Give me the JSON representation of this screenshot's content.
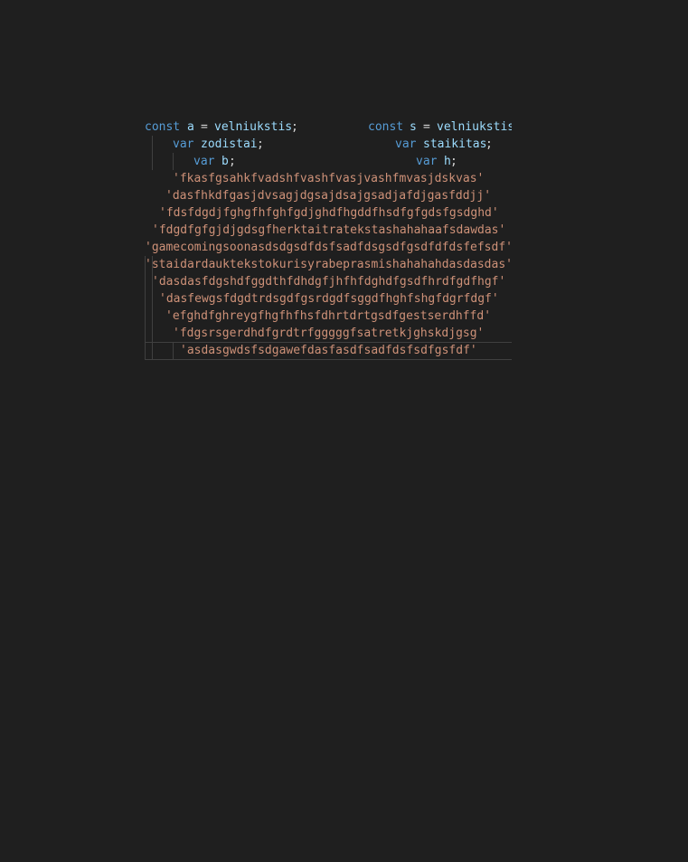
{
  "editor": {
    "header_left": {
      "kw": "const",
      "var": "a",
      "eq": "=",
      "value": "velniukstis",
      "semi": ";"
    },
    "header_right": {
      "kw": "const",
      "var": "s",
      "eq": "=",
      "value": "velniukstis"
    },
    "line2_left": {
      "kw": "var",
      "name": "zodistai",
      "semi": ";"
    },
    "line2_right": {
      "kw": "var",
      "name": "staikitas",
      "semi": ";"
    },
    "line3_left": {
      "kw": "var",
      "name": "b",
      "semi": ";"
    },
    "line3_right": {
      "kw": "var",
      "name": "h",
      "semi": ";"
    },
    "strings": [
      "'fkasfgsahkfvadshfvashfvasjvashfmvasjdskvas'",
      "'dasfhkdfgasjdvsagjdgsajdsajgsadjafdjgasfddjj'",
      "'fdsfdgdjfghgfhfghfgdjghdfhgddfhsdfgfgdsfgsdghd'",
      "'fdgdfgfgjdjgdsgfherktaitratekstashahahaafsdawdas'",
      "'gamecomingsoonasdsdgsdfdsfsadfdsgsdfgsdfdfdsfefsdf'",
      "'staidardauktekstokurisyrabeprasmishahahahdasdasdas'",
      "'dasdasfdgshdfggdthfdhdgfjhfhfdghdfgsdfhrdfgdfhgf'",
      "'dasfewgsfdgdtrdsgdfgsrdgdfsggdfhghfshgfdgrfdgf'",
      "'efghdfghreygfhgfhfhsfdhrtdrtgsdfgestserdhffd'",
      "'fdgsrsgerdhdfgrdtrfgggggfsatretkjghskdjgsg'",
      "'asdasgwdsfsdgawefdasfasdfsadfdsfsdfgsfdf'"
    ]
  }
}
